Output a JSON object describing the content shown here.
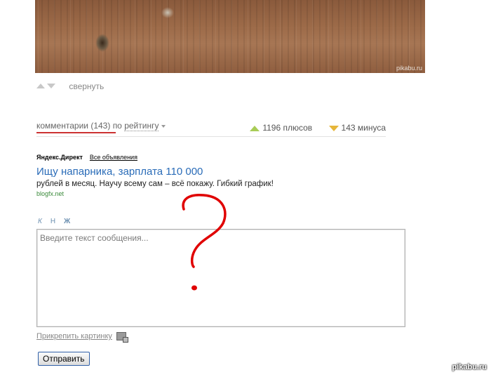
{
  "photo": {
    "watermark": "pikabu.ru"
  },
  "post_controls": {
    "collapse_label": "свернуть"
  },
  "comments": {
    "label": "комментарии",
    "count": "(143)",
    "by": "по",
    "sort": "рейтингу",
    "pluses": "1196 плюсов",
    "minuses": "143 минуса"
  },
  "ad": {
    "brand": "Яндекс.Директ",
    "all_ads": "Все объявления",
    "title": "Ищу напарника, зарплата 110 000",
    "text": "рублей в месяц. Научу всему сам – всё покажу. Гибкий график!",
    "domain": "blogfx.net"
  },
  "formatting": {
    "italic": "К",
    "normal": "Н",
    "bold": "Ж"
  },
  "composer": {
    "placeholder": "Введите текст сообщения...",
    "attach_label": "Прикрепить картинку",
    "submit_label": "Отправить"
  },
  "watermark": "pikabu.ru",
  "colors": {
    "accent_link": "#2a6cb8",
    "sort_underline": "#cc3333",
    "plus": "#a8cc56",
    "minus": "#e6b63a",
    "question_mark": "#e00000"
  }
}
